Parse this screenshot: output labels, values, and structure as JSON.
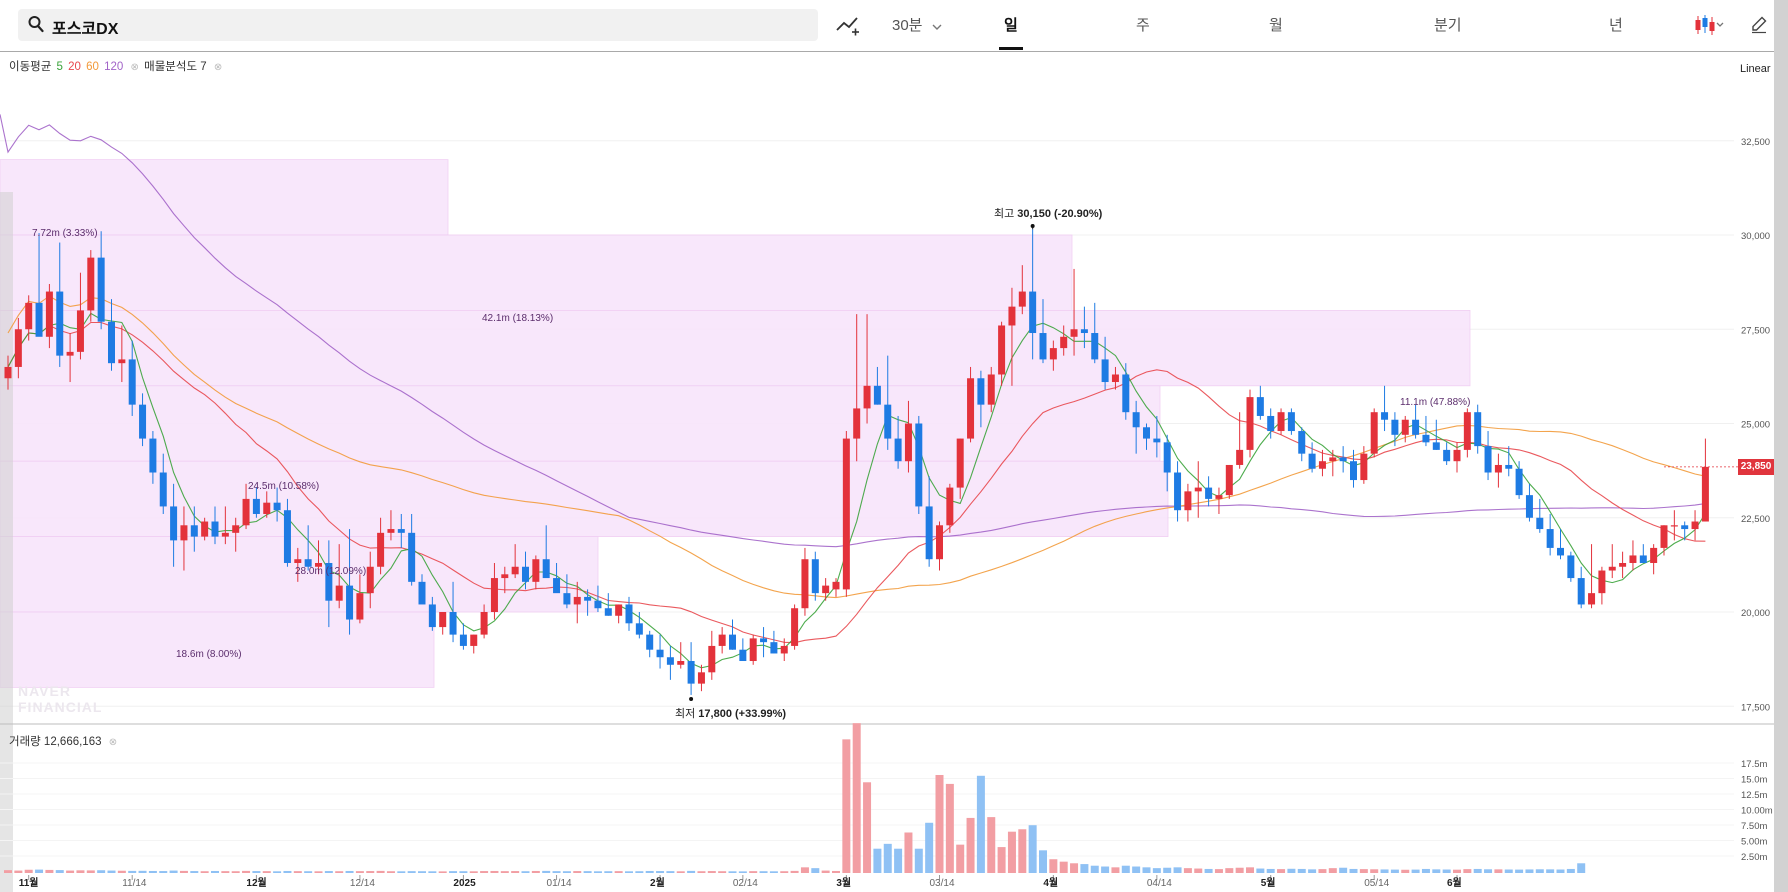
{
  "search": {
    "query": "포스코DX",
    "icon": "search-icon"
  },
  "toolbar": {
    "interval": "30분",
    "periods": [
      "일",
      "주",
      "월",
      "분기",
      "년"
    ],
    "active_period": "일",
    "icons": [
      "indicator-trend-icon",
      "chevron-down-icon",
      "candle-type-icon",
      "pencil-icon"
    ]
  },
  "indicators": {
    "ma_label": "이동평균",
    "ma_periods": [
      {
        "label": "5",
        "color": "#3aa33a"
      },
      {
        "label": "20",
        "color": "#e8474d"
      },
      {
        "label": "60",
        "color": "#f29a3a"
      },
      {
        "label": "120",
        "color": "#a264c8"
      }
    ],
    "volume_profile_label": "매물분석도 7"
  },
  "scale_mode": "Linear",
  "volume": {
    "label": "거래량 12,666,163"
  },
  "watermark": [
    "NAVER",
    "FINANCIAL"
  ],
  "colors": {
    "up": "#e3323b",
    "down": "#1e7be3",
    "volume_up": "#f29ea3",
    "volume_down": "#8fc1f4",
    "profile_fill": "#f8e6fb"
  },
  "current_price": "23,850",
  "chart_data": {
    "type": "candlestick",
    "price_axis": {
      "ticks": [
        "32,500",
        "30,000",
        "27,500",
        "25,000",
        "22,500",
        "20,000",
        "17,500"
      ],
      "range": [
        16500,
        34500
      ]
    },
    "volume_axis": {
      "ticks": [
        "17.5m",
        "15.0m",
        "12.5m",
        "10.00m",
        "7.50m",
        "5.00m",
        "2.50m"
      ],
      "range": [
        0,
        20000000
      ]
    },
    "x_labels": [
      "11월",
      "11/14",
      "12월",
      "12/14",
      "2025",
      "01/14",
      "2월",
      "02/14",
      "3월",
      "03/14",
      "4월",
      "04/14",
      "5월",
      "05/14",
      "6월"
    ],
    "annotations": {
      "high": {
        "label": "최고",
        "value": "30,150 (-20.90%)"
      },
      "low": {
        "label": "최저",
        "value": "17,800 (+33.99%)"
      }
    },
    "volume_profile": [
      {
        "low": 30000,
        "high": 32000,
        "label": "7.72m (3.33%)"
      },
      {
        "low": 28000,
        "high": 30000,
        "label": "42.1m (18.13%)"
      },
      {
        "low": 26000,
        "high": 28000,
        "label": "11.1m (47.88%)"
      },
      {
        "low": 24000,
        "high": 26000,
        "label": ""
      },
      {
        "low": 22000,
        "high": 24000,
        "label": "24.5m (10.58%)"
      },
      {
        "low": 20000,
        "high": 22000,
        "label": "28.0m (12.09%)"
      },
      {
        "low": 18000,
        "high": 20000,
        "label": "18.6m (8.00%)"
      }
    ],
    "candles": [
      [
        26200,
        26800,
        25900,
        26500
      ],
      [
        26500,
        27800,
        26200,
        27500
      ],
      [
        27500,
        28400,
        27200,
        28200
      ],
      [
        28200,
        30050,
        27800,
        27300
      ],
      [
        27300,
        28700,
        27000,
        28500
      ],
      [
        28500,
        29800,
        26500,
        26800
      ],
      [
        26800,
        27400,
        26100,
        26900
      ],
      [
        26900,
        29000,
        26700,
        28000
      ],
      [
        28000,
        29600,
        27700,
        29400
      ],
      [
        29400,
        30100,
        27500,
        27700
      ],
      [
        27700,
        28300,
        26400,
        26600
      ],
      [
        26600,
        27600,
        26100,
        26700
      ],
      [
        26700,
        27200,
        25200,
        25500
      ],
      [
        25500,
        25800,
        24400,
        24600
      ],
      [
        24600,
        24800,
        23400,
        23700
      ],
      [
        23700,
        24200,
        22600,
        22800
      ],
      [
        22800,
        23400,
        21200,
        21900
      ],
      [
        21900,
        22800,
        21100,
        22300
      ],
      [
        22300,
        22800,
        21600,
        22000
      ],
      [
        22000,
        22500,
        21900,
        22400
      ],
      [
        22400,
        22800,
        21800,
        22000
      ],
      [
        22000,
        22800,
        21800,
        22100
      ],
      [
        22100,
        22500,
        21600,
        22300
      ],
      [
        22300,
        23400,
        22200,
        23000
      ],
      [
        23000,
        23300,
        22500,
        22600
      ],
      [
        22600,
        23200,
        22500,
        22900
      ],
      [
        22900,
        23300,
        22400,
        22700
      ],
      [
        22700,
        23000,
        21200,
        21300
      ],
      [
        21300,
        21700,
        20800,
        21400
      ],
      [
        21400,
        22300,
        21100,
        21200
      ],
      [
        21200,
        21900,
        21000,
        21300
      ],
      [
        21300,
        21900,
        19600,
        20300
      ],
      [
        20300,
        21800,
        20100,
        20700
      ],
      [
        20700,
        22200,
        19400,
        19800
      ],
      [
        19800,
        21000,
        19700,
        20500
      ],
      [
        20500,
        21600,
        20100,
        21200
      ],
      [
        21200,
        22500,
        21000,
        22100
      ],
      [
        22100,
        22700,
        21900,
        22200
      ],
      [
        22200,
        22600,
        21700,
        22100
      ],
      [
        22100,
        22600,
        20700,
        20800
      ],
      [
        20800,
        21000,
        20500,
        20200
      ],
      [
        20200,
        20400,
        19500,
        19600
      ],
      [
        19600,
        19900,
        19400,
        20000
      ],
      [
        20000,
        20800,
        19200,
        19400
      ],
      [
        19400,
        19700,
        19000,
        19100
      ],
      [
        19100,
        19400,
        18900,
        19400
      ],
      [
        19400,
        20200,
        19300,
        20000
      ],
      [
        20000,
        21300,
        19800,
        20900
      ],
      [
        20900,
        21200,
        20500,
        21000
      ],
      [
        21000,
        21800,
        20900,
        21200
      ],
      [
        21200,
        21600,
        20600,
        20800
      ],
      [
        20800,
        21500,
        20600,
        21400
      ],
      [
        21400,
        22300,
        21200,
        20900
      ],
      [
        20900,
        21300,
        20600,
        20500
      ],
      [
        20500,
        21000,
        20100,
        20200
      ],
      [
        20200,
        20800,
        19700,
        20400
      ],
      [
        20400,
        20600,
        19900,
        20300
      ],
      [
        20300,
        20700,
        20000,
        20100
      ],
      [
        20100,
        20500,
        19900,
        19900
      ],
      [
        19900,
        20200,
        19700,
        20200
      ],
      [
        20200,
        20400,
        19500,
        19700
      ],
      [
        19700,
        20000,
        19300,
        19400
      ],
      [
        19400,
        19500,
        18800,
        19000
      ],
      [
        19000,
        19400,
        18500,
        18800
      ],
      [
        18800,
        19100,
        18200,
        18600
      ],
      [
        18600,
        19200,
        18500,
        18700
      ],
      [
        18700,
        19200,
        17800,
        18100
      ],
      [
        18100,
        18600,
        17900,
        18400
      ],
      [
        18400,
        19500,
        18200,
        19100
      ],
      [
        19100,
        19600,
        18900,
        19400
      ],
      [
        19400,
        19800,
        19000,
        19000
      ],
      [
        19000,
        19300,
        18700,
        18700
      ],
      [
        18700,
        19400,
        18600,
        19300
      ],
      [
        19300,
        19600,
        18800,
        19200
      ],
      [
        19200,
        19500,
        18900,
        18900
      ],
      [
        18900,
        19300,
        18700,
        19100
      ],
      [
        19100,
        20200,
        19000,
        20100
      ],
      [
        20100,
        21700,
        19900,
        21400
      ],
      [
        21400,
        21600,
        20300,
        20500
      ],
      [
        20500,
        20900,
        20300,
        20700
      ],
      [
        20600,
        20900,
        20400,
        20800
      ],
      [
        20600,
        24800,
        20400,
        24600
      ],
      [
        24600,
        27900,
        24000,
        25400
      ],
      [
        25400,
        27900,
        25000,
        26000
      ],
      [
        26000,
        26500,
        25500,
        25500
      ],
      [
        25500,
        26800,
        24300,
        24600
      ],
      [
        24600,
        25200,
        23800,
        24000
      ],
      [
        24000,
        25600,
        23700,
        25000
      ],
      [
        25000,
        25200,
        22600,
        22800
      ],
      [
        22800,
        23600,
        21200,
        21400
      ],
      [
        21400,
        22400,
        21100,
        22300
      ],
      [
        22300,
        23400,
        22100,
        23300
      ],
      [
        23300,
        24600,
        23000,
        24600
      ],
      [
        24600,
        26500,
        24500,
        26200
      ],
      [
        26200,
        26400,
        24900,
        25500
      ],
      [
        25500,
        26500,
        25300,
        26300
      ],
      [
        26300,
        27700,
        26000,
        27600
      ],
      [
        27600,
        28600,
        26000,
        28100
      ],
      [
        28100,
        29200,
        27900,
        28500
      ],
      [
        28500,
        30150,
        26700,
        27400
      ],
      [
        27400,
        28300,
        26600,
        26700
      ],
      [
        26700,
        27200,
        26400,
        27000
      ],
      [
        27000,
        27600,
        26800,
        27300
      ],
      [
        27300,
        29100,
        26800,
        27500
      ],
      [
        27500,
        28100,
        27000,
        27400
      ],
      [
        27400,
        28200,
        26600,
        26700
      ],
      [
        26700,
        27300,
        25900,
        26100
      ],
      [
        26100,
        26500,
        25900,
        26300
      ],
      [
        26300,
        26600,
        25100,
        25300
      ],
      [
        25300,
        25600,
        24200,
        24900
      ],
      [
        24900,
        25000,
        24300,
        24600
      ],
      [
        24600,
        25200,
        24100,
        24500
      ],
      [
        24500,
        24700,
        23200,
        23700
      ],
      [
        23700,
        24000,
        22400,
        22700
      ],
      [
        22700,
        23400,
        22400,
        23200
      ],
      [
        23200,
        24000,
        22500,
        23300
      ],
      [
        23300,
        23600,
        22800,
        23000
      ],
      [
        23000,
        23300,
        22600,
        23100
      ],
      [
        23100,
        23900,
        23000,
        23900
      ],
      [
        23900,
        25300,
        23800,
        24300
      ],
      [
        24300,
        25900,
        24100,
        25700
      ],
      [
        25700,
        26000,
        25100,
        25200
      ],
      [
        25200,
        25400,
        24600,
        24800
      ],
      [
        24800,
        25400,
        24700,
        25300
      ],
      [
        25300,
        25400,
        24700,
        24800
      ],
      [
        24800,
        24900,
        24000,
        24200
      ],
      [
        24200,
        24500,
        23700,
        23800
      ],
      [
        23800,
        24300,
        23600,
        24000
      ],
      [
        24000,
        24300,
        23600,
        24100
      ],
      [
        24100,
        24400,
        23700,
        24000
      ],
      [
        24000,
        24300,
        23300,
        23500
      ],
      [
        23500,
        24400,
        23400,
        24200
      ],
      [
        24200,
        25400,
        24100,
        25300
      ],
      [
        25300,
        26000,
        24800,
        25100
      ],
      [
        25100,
        25300,
        24400,
        24700
      ],
      [
        24700,
        25200,
        24500,
        25100
      ],
      [
        25100,
        25500,
        24600,
        24700
      ],
      [
        24700,
        25200,
        24400,
        24500
      ],
      [
        24500,
        25100,
        24300,
        24300
      ],
      [
        24300,
        24500,
        23900,
        24000
      ],
      [
        24000,
        24500,
        23700,
        24300
      ],
      [
        24300,
        25400,
        24100,
        25300
      ],
      [
        25300,
        25500,
        24200,
        24400
      ],
      [
        24400,
        24800,
        23500,
        23700
      ],
      [
        23700,
        24200,
        23300,
        23900
      ],
      [
        23900,
        24400,
        23600,
        23800
      ],
      [
        23800,
        24000,
        23000,
        23100
      ],
      [
        23100,
        23400,
        22400,
        22500
      ],
      [
        22500,
        23000,
        22100,
        22200
      ],
      [
        22200,
        22600,
        21500,
        21700
      ],
      [
        21700,
        22200,
        21400,
        21500
      ],
      [
        21500,
        21600,
        20800,
        20900
      ],
      [
        20900,
        21200,
        20100,
        20200
      ],
      [
        20200,
        21800,
        20100,
        20500
      ],
      [
        20500,
        21200,
        20200,
        21100
      ],
      [
        21100,
        21800,
        20900,
        21200
      ],
      [
        21200,
        21600,
        20900,
        21300
      ],
      [
        21300,
        21900,
        21100,
        21500
      ],
      [
        21500,
        21800,
        21300,
        21300
      ],
      [
        21300,
        21800,
        21000,
        21700
      ],
      [
        21700,
        22300,
        21500,
        22300
      ],
      [
        22300,
        22700,
        21900,
        22300
      ],
      [
        22300,
        22400,
        21900,
        22200
      ],
      [
        22200,
        22700,
        21900,
        22400
      ],
      [
        22400,
        24600,
        22400,
        23850
      ]
    ],
    "volumes": [
      350000,
      300000,
      400000,
      420000,
      380000,
      360000,
      300000,
      330000,
      320000,
      340000,
      300000,
      280000,
      260000,
      270000,
      250000,
      240000,
      300000,
      260000,
      240000,
      220000,
      250000,
      230000,
      220000,
      260000,
      240000,
      230000,
      210000,
      250000,
      230000,
      220000,
      210000,
      240000,
      220000,
      250000,
      230000,
      240000,
      260000,
      220000,
      210000,
      230000,
      220000,
      210000,
      200000,
      230000,
      220000,
      210000,
      240000,
      250000,
      230000,
      240000,
      220000,
      250000,
      260000,
      230000,
      220000,
      240000,
      230000,
      210000,
      220000,
      230000,
      210000,
      220000,
      250000,
      240000,
      230000,
      210000,
      260000,
      220000,
      240000,
      220000,
      210000,
      200000,
      230000,
      220000,
      210000,
      220000,
      260000,
      700000,
      600000,
      300000,
      250000,
      16500000,
      18500000,
      11200000,
      3000000,
      3600000,
      3000000,
      5000000,
      3000000,
      6200000,
      12100000,
      11000000,
      3500000,
      6800000,
      12000000,
      6900000,
      3200000,
      5100000,
      5400000,
      5900000,
      2800000,
      1700000,
      1400000,
      1200000,
      1100000,
      900000,
      800000,
      700000,
      900000,
      800000,
      700000,
      600000,
      650000,
      700000,
      600000,
      550000,
      500000,
      480000,
      600000,
      650000,
      700000,
      550000,
      500000,
      480000,
      520000,
      500000,
      450000,
      480000,
      600000,
      650000,
      500000,
      480000,
      460000,
      440000,
      420000,
      400000,
      420000,
      500000,
      450000,
      430000,
      410000,
      480000,
      500000,
      460000,
      450000,
      430000,
      420000,
      440000,
      460000,
      450000,
      430000,
      500000,
      1200000
    ]
  }
}
